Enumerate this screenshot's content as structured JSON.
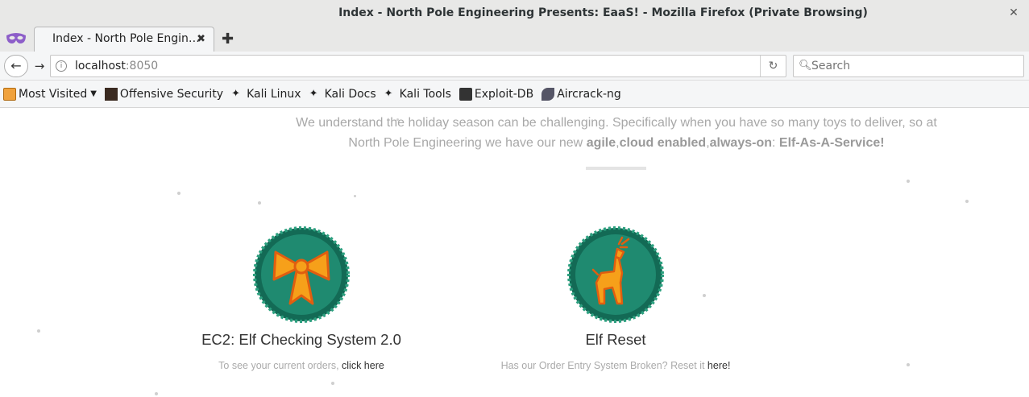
{
  "window": {
    "title": "Index - North Pole Engineering Presents: EaaS! - Mozilla Firefox (Private Browsing)"
  },
  "tab": {
    "label": "Index - North Pole Engin…"
  },
  "url": {
    "host": "localhost",
    "port": ":8050"
  },
  "search": {
    "placeholder": "Search"
  },
  "bookmarks": {
    "most_visited": "Most Visited",
    "items": [
      "Offensive Security",
      "Kali Linux",
      "Kali Docs",
      "Kali Tools",
      "Exploit-DB",
      "Aircrack-ng"
    ]
  },
  "page": {
    "intro_line1": "We understand the holiday season can be challenging. Specifically when you have so many toys to deliver, so at",
    "intro_prefix": "North Pole Engineering we have our new ",
    "kw_agile": "agile",
    "kw_cloud": "cloud enabled",
    "kw_always": "always-on",
    "kw_elf": "Elf-As-A-Service!",
    "sep_comma": ",",
    "sep_colon": ": "
  },
  "cards": [
    {
      "title": "EC2: Elf Checking System 2.0",
      "desc": "To see your current orders, ",
      "link": "click here"
    },
    {
      "title": "Elf Reset",
      "desc": "Has our Order Entry System Broken? Reset it ",
      "link": "here!"
    }
  ],
  "colors": {
    "wreath": "#1f8a70",
    "wreath_dark": "#136a55",
    "ornament": "#f6a01a",
    "ornament_stroke": "#e05e10"
  }
}
